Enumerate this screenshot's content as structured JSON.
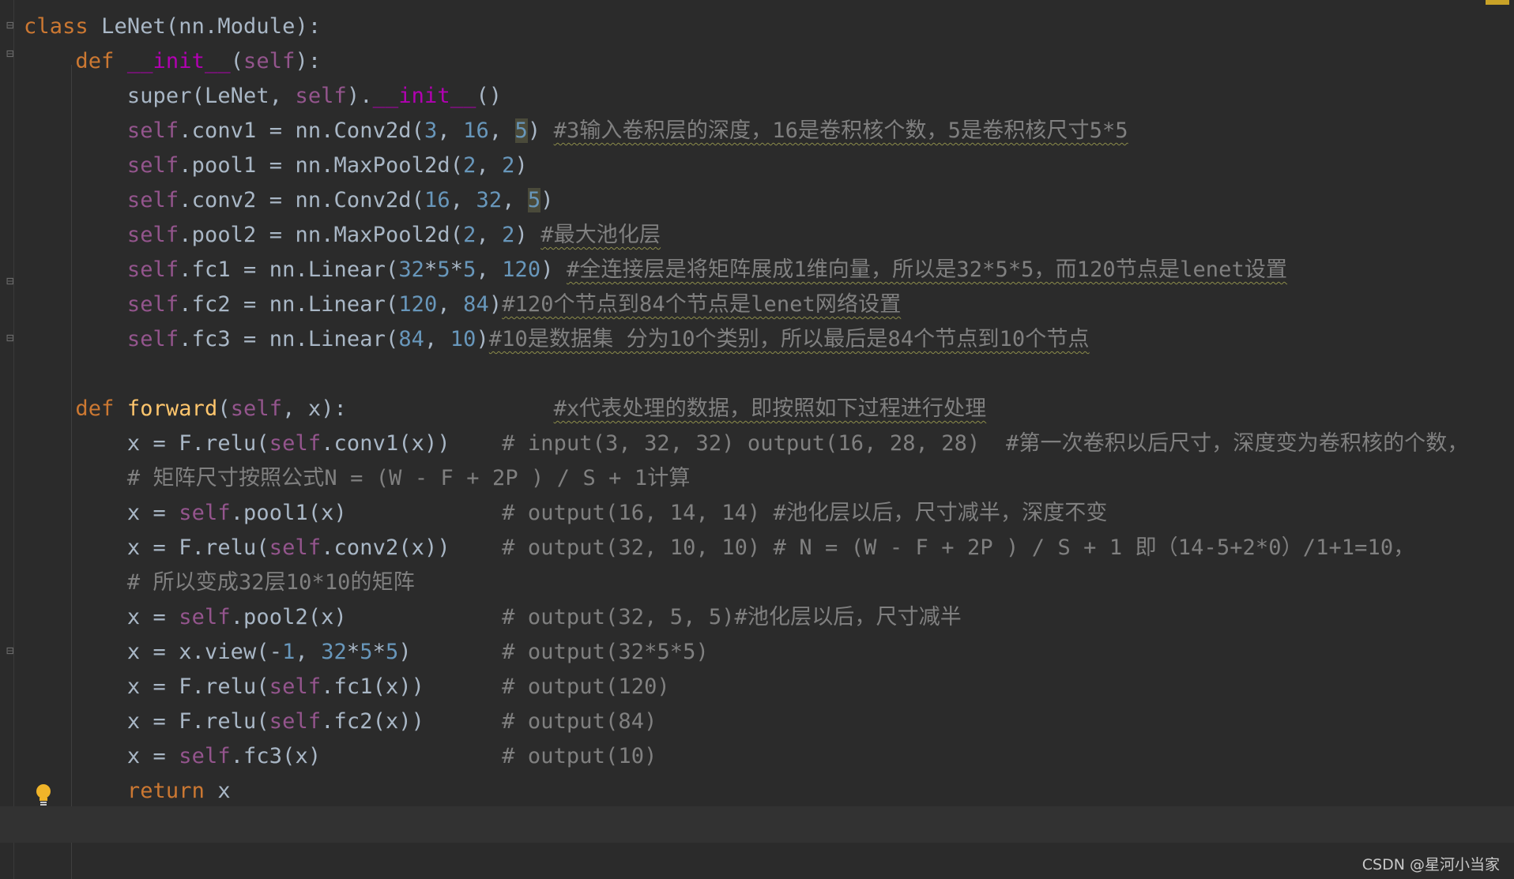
{
  "editor": {
    "lines": [
      [
        [
          "kw",
          "class "
        ],
        [
          "t",
          "LeNet(nn.Module):"
        ]
      ],
      [
        [
          "t",
          "    "
        ],
        [
          "kw",
          "def "
        ],
        [
          "dunder",
          "__init__"
        ],
        [
          "t",
          "("
        ],
        [
          "self",
          "self"
        ],
        [
          "t",
          "):"
        ]
      ],
      [
        [
          "t",
          "        super(LeNet, "
        ],
        [
          "self",
          "self"
        ],
        [
          "t",
          ")."
        ],
        [
          "dunder",
          "__init__"
        ],
        [
          "t",
          "()"
        ]
      ],
      [
        [
          "t",
          "        "
        ],
        [
          "self",
          "self"
        ],
        [
          "t",
          ".conv1 = nn.Conv2d("
        ],
        [
          "num",
          "3"
        ],
        [
          "t",
          ", "
        ],
        [
          "num",
          "16"
        ],
        [
          "t",
          ", "
        ],
        [
          "hlnum",
          "5"
        ],
        [
          "t",
          ") "
        ],
        [
          "cmtw",
          "#3输入卷积层的深度，16是卷积核个数，5是卷积核尺寸5*5"
        ]
      ],
      [
        [
          "t",
          "        "
        ],
        [
          "self",
          "self"
        ],
        [
          "t",
          ".pool1 = nn.MaxPool2d("
        ],
        [
          "num",
          "2"
        ],
        [
          "t",
          ", "
        ],
        [
          "num",
          "2"
        ],
        [
          "t",
          ")"
        ]
      ],
      [
        [
          "t",
          "        "
        ],
        [
          "self",
          "self"
        ],
        [
          "t",
          ".conv2 = nn.Conv2d("
        ],
        [
          "num",
          "16"
        ],
        [
          "t",
          ", "
        ],
        [
          "num",
          "32"
        ],
        [
          "t",
          ", "
        ],
        [
          "hlnum",
          "5"
        ],
        [
          "t",
          ")"
        ]
      ],
      [
        [
          "t",
          "        "
        ],
        [
          "self",
          "self"
        ],
        [
          "t",
          ".pool2 = nn.MaxPool2d("
        ],
        [
          "num",
          "2"
        ],
        [
          "t",
          ", "
        ],
        [
          "num",
          "2"
        ],
        [
          "t",
          ") "
        ],
        [
          "cmtw",
          "#最大池化层"
        ]
      ],
      [
        [
          "t",
          "        "
        ],
        [
          "self",
          "self"
        ],
        [
          "t",
          ".fc1 = nn.Linear("
        ],
        [
          "num",
          "32"
        ],
        [
          "t",
          "*"
        ],
        [
          "num",
          "5"
        ],
        [
          "t",
          "*"
        ],
        [
          "num",
          "5"
        ],
        [
          "t",
          ", "
        ],
        [
          "num",
          "120"
        ],
        [
          "t",
          ") "
        ],
        [
          "cmtw",
          "#全连接层是将矩阵展成1维向量，所以是32*5*5，而120节点是lenet设置"
        ]
      ],
      [
        [
          "t",
          "        "
        ],
        [
          "self",
          "self"
        ],
        [
          "t",
          ".fc2 = nn.Linear("
        ],
        [
          "num",
          "120"
        ],
        [
          "t",
          ", "
        ],
        [
          "num",
          "84"
        ],
        [
          "t",
          ")"
        ],
        [
          "cmtw",
          "#120个节点到84个节点是lenet网络设置"
        ]
      ],
      [
        [
          "t",
          "        "
        ],
        [
          "self",
          "self"
        ],
        [
          "t",
          ".fc3 = nn.Linear("
        ],
        [
          "num",
          "84"
        ],
        [
          "t",
          ", "
        ],
        [
          "num",
          "10"
        ],
        [
          "t",
          ")"
        ],
        [
          "cmtw",
          "#10是数据集 分为10个类别，所以最后是84个节点到10个节点"
        ]
      ],
      [
        [
          "t",
          ""
        ]
      ],
      [
        [
          "t",
          "    "
        ],
        [
          "kw",
          "def "
        ],
        [
          "fn",
          "forward"
        ],
        [
          "t",
          "("
        ],
        [
          "self",
          "self"
        ],
        [
          "t",
          ", x):                "
        ],
        [
          "cmtw",
          "#x代表处理的数据，即按照如下过程进行处理"
        ]
      ],
      [
        [
          "t",
          "        x = F.relu("
        ],
        [
          "self",
          "self"
        ],
        [
          "t",
          ".conv1(x))    "
        ],
        [
          "cmt",
          "# input(3, 32, 32) output(16, 28, 28)  #第一次卷积以后尺寸，深度变为卷积核的个数，"
        ]
      ],
      [
        [
          "t",
          "        "
        ],
        [
          "cmt",
          "# 矩阵尺寸按照公式N = (W - F + 2P ) / S + 1计算"
        ]
      ],
      [
        [
          "t",
          "        x = "
        ],
        [
          "self",
          "self"
        ],
        [
          "t",
          ".pool1(x)            "
        ],
        [
          "cmt",
          "# output(16, 14, 14) #池化层以后，尺寸减半，深度不变"
        ]
      ],
      [
        [
          "t",
          "        x = F.relu("
        ],
        [
          "self",
          "self"
        ],
        [
          "t",
          ".conv2(x))    "
        ],
        [
          "cmt",
          "# output(32, 10, 10) # N = (W - F + 2P ) / S + 1 即（14-5+2*0）/1+1=10，"
        ]
      ],
      [
        [
          "t",
          "        "
        ],
        [
          "cmt",
          "# 所以变成32层10*10的矩阵"
        ]
      ],
      [
        [
          "t",
          "        x = "
        ],
        [
          "self",
          "self"
        ],
        [
          "t",
          ".pool2(x)            "
        ],
        [
          "cmt",
          "# output(32, 5, 5)#池化层以后，尺寸减半"
        ]
      ],
      [
        [
          "t",
          "        x = x.view(-"
        ],
        [
          "num",
          "1"
        ],
        [
          "t",
          ", "
        ],
        [
          "num",
          "32"
        ],
        [
          "t",
          "*"
        ],
        [
          "num",
          "5"
        ],
        [
          "t",
          "*"
        ],
        [
          "num",
          "5"
        ],
        [
          "t",
          ")       "
        ],
        [
          "cmt",
          "# output(32*5*5)"
        ]
      ],
      [
        [
          "t",
          "        x = F.relu("
        ],
        [
          "self",
          "self"
        ],
        [
          "t",
          ".fc1(x))      "
        ],
        [
          "cmt",
          "# output(120)"
        ]
      ],
      [
        [
          "t",
          "        x = F.relu("
        ],
        [
          "self",
          "self"
        ],
        [
          "t",
          ".fc2(x))      "
        ],
        [
          "cmt",
          "# output(84)"
        ]
      ],
      [
        [
          "t",
          "        x = "
        ],
        [
          "self",
          "self"
        ],
        [
          "t",
          ".fc3(x)              "
        ],
        [
          "cmt",
          "# output(10)"
        ]
      ],
      [
        [
          "t",
          "        "
        ],
        [
          "kw",
          "return "
        ],
        [
          "t",
          "x"
        ]
      ]
    ]
  },
  "gutter": {
    "fold_markers": [
      "fold-class",
      "fold-init",
      "fold-init-end",
      "fold-forward",
      "fold-forward-end"
    ]
  },
  "watermark": "CSDN @星河小当家",
  "colors": {
    "background": "#2b2b2b",
    "keyword": "#cc7832",
    "self": "#94558d",
    "number": "#6897bb",
    "dunder": "#b200b2",
    "function": "#ffc66d",
    "comment": "#808080",
    "text": "#a9b7c6"
  },
  "icons": [
    "fold-icon",
    "lightbulb-icon"
  ]
}
